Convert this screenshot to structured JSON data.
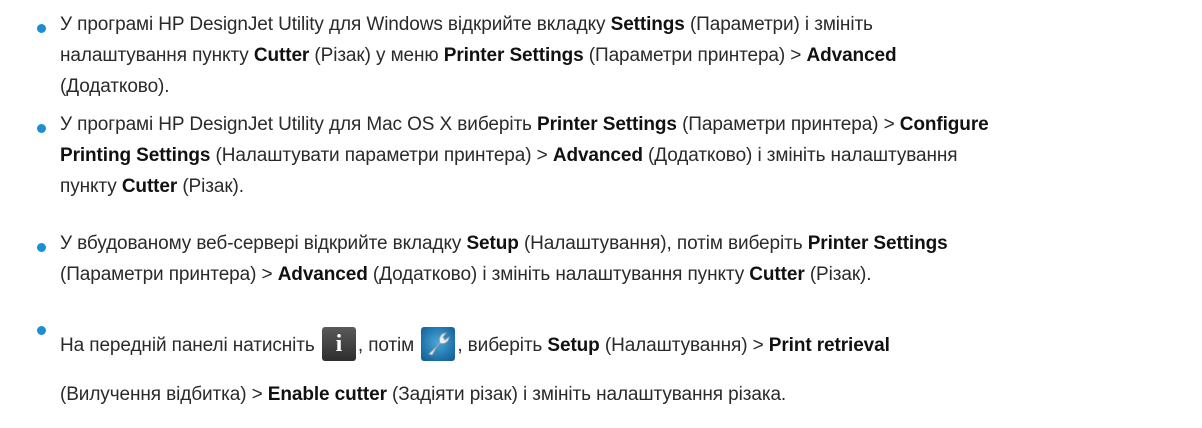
{
  "accent_color": "#1a8fd6",
  "items": [
    {
      "lines": [
        [
          "У програмі HP DesignJet Utility для Windows відкрийте вкладку ",
          {
            "b": "Settings"
          },
          " (Параметри) і змініть"
        ],
        [
          "налаштування пункту ",
          {
            "b": "Cutter"
          },
          " (Різак) у меню ",
          {
            "b": "Printer Settings"
          },
          " (Параметри принтера) > ",
          {
            "b": "Advanced"
          }
        ],
        [
          "(Додатково)."
        ]
      ]
    },
    {
      "lines": [
        [
          "У програмі HP DesignJet Utility для Mac OS X виберіть ",
          {
            "b": "Printer Settings"
          },
          " (Параметри принтера) > ",
          {
            "b": "Configure"
          }
        ],
        [
          {
            "b": "Printing Settings"
          },
          " (Налаштувати параметри принтера) > ",
          {
            "b": "Advanced"
          },
          " (Додатково) і змініть налаштування"
        ],
        [
          "пункту ",
          {
            "b": "Cutter"
          },
          " (Різак)."
        ]
      ]
    },
    {
      "lines": [
        [
          "У вбудованому веб-сервері відкрийте вкладку ",
          {
            "b": "Setup"
          },
          " (Налаштування), потім виберіть ",
          {
            "b": "Printer Settings"
          }
        ],
        [
          "(Параметри принтера) > ",
          {
            "b": "Advanced"
          },
          " (Додатково) і змініть налаштування пункту ",
          {
            "b": "Cutter"
          },
          " (Різак)."
        ]
      ]
    },
    {
      "lines": [
        [
          "На передній панелі натисніть ",
          {
            "icon": "info-icon"
          },
          ", потім ",
          {
            "icon": "wrench-icon"
          },
          ", виберіть ",
          {
            "b": "Setup"
          },
          " (Налаштування) > ",
          {
            "b": "Print retrieval"
          }
        ],
        [
          "(Вилучення відбитка) > ",
          {
            "b": "Enable cutter"
          },
          " (Задіяти різак) і змініть налаштування різака."
        ]
      ]
    }
  ]
}
